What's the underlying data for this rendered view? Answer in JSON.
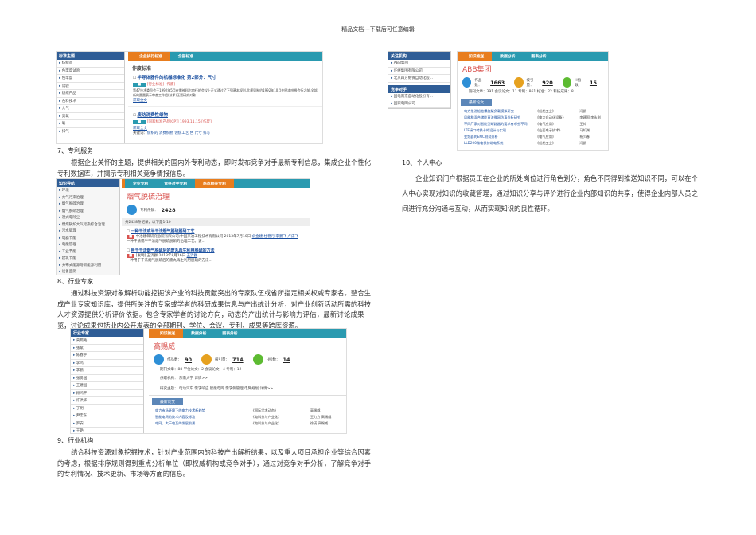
{
  "header": "精品文档---下载后可任意编辑",
  "shot1": {
    "sidebar_title": "标准主题",
    "sidebar_items": [
      "纺织品",
      "色牢度试验",
      "色牢度",
      "试验",
      "纺织产品",
      "色料技术",
      "大气",
      "臭氧",
      "氧",
      "排气"
    ],
    "tabs": [
      "企业执行标准",
      "全部标准"
    ],
    "heading": "作废标准",
    "items": [
      {
        "title": "半导体器件的机械标准化 第2部分：尺寸",
        "tag": "[行业标准] [作废]",
        "desc": "第47技术委员会于1992年5月在雷神科尔审行的会议上正式通过了下列基本规则,此规则制约1992年10月在明本哈根会行之前,全部新的圆圆表示审查工作组(技术)正要研究对象 ...",
        "more": "获取全文"
      },
      {
        "title": "废纺消费性织物",
        "tag": "[国家标准产品(CP)] 1993.11.15 [作废]",
        "desc": "获取全文",
        "kw_label": "关键词：",
        "keywords": "纺织的 消费织物 领纺工艺 色 尺寸 排写"
      }
    ]
  },
  "section7": {
    "heading": "7、专利服务",
    "body": "根据企业关怀的主题，提供相关的国内外专利动态，即时发布竞争对手最新专利信息，集成企业个性化专利数据库，并揭示专利相关竞争情报信息。"
  },
  "shot2": {
    "sidebar_title": "知识导航",
    "sidebar_items": [
      "环境",
      "大气污染治理",
      "烟气脱硫治理",
      "烟气脱硝治理",
      "湿式电除尘",
      "燃煤锅炉大气污染综合治理",
      "污水处理",
      "电器节能",
      "电能管理",
      "工业节能",
      "建筑节能",
      "分布式能源与新能源利用",
      "设备监测"
    ],
    "tabs": [
      "企业专利",
      "竞争对手专利",
      "热点相关专利"
    ],
    "title": "烟气脱硫治理",
    "count_label": "专利件数：",
    "count": "2428",
    "summary": "共2428条记录，以下是1-10",
    "items": [
      {
        "title": "一种干法或半干法烟气脱硫脱硝工艺",
        "meta": "中冶建筑研究总院有限公司;中国京冶工程技术有限公司 2013年7月10日",
        "authors": "俞金建 杜稳丹 李鹏飞 卢成飞",
        "desc": "一种干法或半干法烟气脱硫脱硝的治理工艺。该..."
      },
      {
        "title": "用于干法烟气脱硫后的废丸再生利用脱硫的方法",
        "meta": "[发明] 王沂群 2013年8月16日",
        "authors": "王沂群",
        "desc": "一种用于干法烟气脱硫后的废丸再生利用脱硫的方法..."
      }
    ]
  },
  "section8": {
    "heading": "8、行业专家",
    "body": "通过科技资源对象解析功能挖掘该产业的科技贡献突出的专家队伍或省所指定相关权威专家名。整合生成产业专家知识库，提供所关注的专家或学者的科研成果信息与产出统计分析，对产业创新活动所需的科技人才资源提供分析评价依据。包含专家学者的讨论方向，动态的产出统计与影响力评估，最新讨论成果一览，讨论成果包括业内公开发表的全部期刊、学位、会议、专利、成果等跨库资源。"
  },
  "shot3": {
    "sidebar_title": "行业专家",
    "sidebar_items": [
      "高赐威",
      "张斌",
      "陈春宇",
      "李鸣",
      "李鹏",
      "张勇国",
      "王建国",
      "顾鸿平",
      "许洪华",
      "丁明",
      "尹忠东",
      "罗安",
      "王艳"
    ],
    "tabs": [
      "知识推送",
      "数据分析",
      "图表分析"
    ],
    "name": "高赐威",
    "works_label": "作品数：",
    "works": "90",
    "cited_label": "被引量：",
    "cited": "714",
    "h_label": "H指数：",
    "h": "14",
    "breakdown": "期刊文章：88   学位论文：2   会议论文：4   专利：12",
    "org": "供职机构： 东南大学  详情>>",
    "topics": "研究主题： 电动汽车 需求响应 智能电网 需求侧管理 电网规划  详情>>",
    "ribbon": "最新论文",
    "papers": [
      [
        "电力市场环境下的电力技术新趋势",
        "《国际学术动态》",
        "高赐威"
      ],
      [
        "智能电网的技术内容及标准",
        "《电科技与产业化》",
        "王力方 高赐威"
      ],
      [
        "电网、大干电互的发展前景",
        "《电科技与产业化》",
        "徐瑛 高赐威"
      ]
    ]
  },
  "section9": {
    "heading": "9、行业机构",
    "body": "结合科技资源对象挖掘技术，针对产业范围内的科技产出解析结果，以及重大项目承担企业等综合因素的考虑，根据排序规则得到重点分析单位（即权威机构或竞争对手），通过对竞争对手分析，了解竞争对手的专利情况、技术更新、市场等方面的信息。"
  },
  "shot4": {
    "side1_title": "关注机构",
    "side1_items": [
      "ABB集团",
      "许继集团有限公司",
      "北京四方继保自动化股..."
    ],
    "side2_title": "竞争对手",
    "side2_items": [
      "国电南京自动化股份有...",
      "国家电网公司"
    ],
    "tabs": [
      "知识推送",
      "数据分析",
      "图表分析"
    ],
    "name": "ABB集团",
    "works_label": "作品数：",
    "works": "1663",
    "cited_label": "被引量：",
    "cited": "920",
    "h_label": "H指数：",
    "h": "15",
    "breakdown": "期刊文章：391   会议论文：11   专利：861   标准：22   科技成果：8",
    "ribbon": "最新论文",
    "papers": [
      [
        "电力推进船舶螺旋桨负载模拟研究",
        "《船舶工业》",
        "冯凯"
      ],
      [
        "风能和混合储能直流微网仿真分析研究",
        "《电力自动化设备》",
        "李建国 李永刚"
      ],
      [
        "不同厂家对智能型断路器的要求有哪些不同",
        "《电气应用》",
        "王帅"
      ],
      [
        "LTE接口转换卡的设计与实现",
        "《山西电子技术》",
        "马知渊"
      ],
      [
        "变频器的EMC测试分析",
        "《电气应用》",
        "杨少春"
      ],
      [
        "LLD200微电保护继电系统",
        "《船舶工业》",
        "冯凯"
      ]
    ]
  },
  "section10": {
    "heading": "10、个人中心",
    "body": "企业知识门户根据员工在企业的所处岗位进行角色划分，角色不同得到推送知识不同，可以在个人中心实现对知识的收藏管理，通过知识分享与评价进行企业内部知识的共享，使得企业内部人员之间进行充分沟通与互动，从而实现知识的良性循环。"
  },
  "colors": {
    "tab_orange": "#e87d1e",
    "tab_teal": "#2a9ab0",
    "sidebar_blue": "#2f5d96",
    "title_red": "#d9534f",
    "circle_blue": "#2e8fd6",
    "circle_gold": "#e6a11f",
    "circle_green": "#5dbb32"
  }
}
